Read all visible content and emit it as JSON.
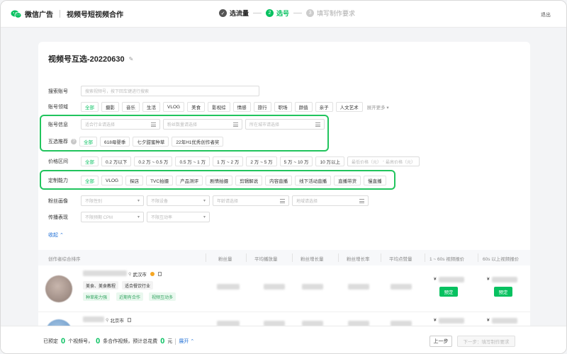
{
  "header": {
    "brand": "微信广告",
    "product": "视频号短视频合作",
    "steps": [
      {
        "num": "✓",
        "label": "选流量",
        "state": "done"
      },
      {
        "num": "2",
        "label": "选号",
        "state": "active"
      },
      {
        "num": "3",
        "label": "填写制作要求",
        "state": "todo"
      }
    ],
    "exit": "退出"
  },
  "card": {
    "title": "视频号互选-20220630"
  },
  "filters": {
    "search": {
      "label": "搜索账号",
      "placeholder": "搜索视频号，按下回车键进行搜索"
    },
    "domain": {
      "label": "账号领域",
      "chips": [
        "全部",
        "摄影",
        "音乐",
        "生活",
        "VLOG",
        "美食",
        "影视综",
        "情感",
        "旅行",
        "职场",
        "颜值",
        "亲子",
        "人文艺术"
      ],
      "more": "展开更多"
    },
    "account_info": {
      "label": "账号信息",
      "selects": [
        "适合行业请选择",
        "粉丝数量请选择",
        "所在城市请选择"
      ]
    },
    "recommend": {
      "label": "互选推荐",
      "chips": [
        "全部",
        "618母婴季",
        "七夕甜蜜种草",
        "22年H1优秀创作者奖"
      ]
    },
    "price": {
      "label": "价格区间",
      "chips": [
        "全部",
        "0.2 万以下",
        "0.2 万 ~ 0.5 万",
        "0.5 万 ~ 1 万",
        "1 万 ~ 2 万",
        "2 万 ~ 5 万",
        "5 万 ~ 10 万",
        "10 万以上"
      ],
      "min_placeholder": "最低价格（元）",
      "sep": "-",
      "max_placeholder": "最高价格（元）"
    },
    "custom": {
      "label": "定制能力",
      "chips": [
        "全部",
        "VLOG",
        "探店",
        "TVC拍摄",
        "产品测评",
        "剧情拍摄",
        "剪辑解说",
        "内容直播",
        "线下活动直播",
        "直播带货",
        "慢直播"
      ]
    },
    "fans": {
      "label": "粉丝画像",
      "selects": [
        "不限性别",
        "不限设备",
        "年龄请选择",
        "地域请选择"
      ]
    },
    "spread": {
      "label": "传播表现",
      "selects": [
        "不限预期 CPM",
        "不限互动率"
      ]
    },
    "collapse": "收起"
  },
  "table": {
    "headers": [
      "创作者综合排序",
      "粉丝量",
      "平均播放量",
      "粉丝增长量",
      "粉丝增长率",
      "平均点赞量",
      "1 ~ 60s 视频报价",
      "60s 以上视频报价"
    ],
    "rows": [
      {
        "city": "武汉市",
        "tags": [
          "美食、美食教程",
          "适合餐饮行业"
        ],
        "green_tags": [
          "种草能力强",
          "近期有合作",
          "视频互动多"
        ],
        "price_symbol": "¥",
        "book_label": "预定"
      },
      {
        "city": "北京市",
        "tags": [],
        "green_tags": [],
        "price_symbol": "¥",
        "book_label": ""
      }
    ]
  },
  "footer": {
    "prefix": "已预定",
    "accounts": "0",
    "accounts_unit": "个视频号，",
    "videos": "0",
    "videos_unit": "条合作视频，预计总花费",
    "cost": "0",
    "cost_unit": "元",
    "expand": "展开",
    "prev": "上一步",
    "next": "下一步：填写制作要求"
  },
  "colors": {
    "accent": "#07c160",
    "highlight": "#21c45d",
    "link": "#1f6fd6"
  }
}
